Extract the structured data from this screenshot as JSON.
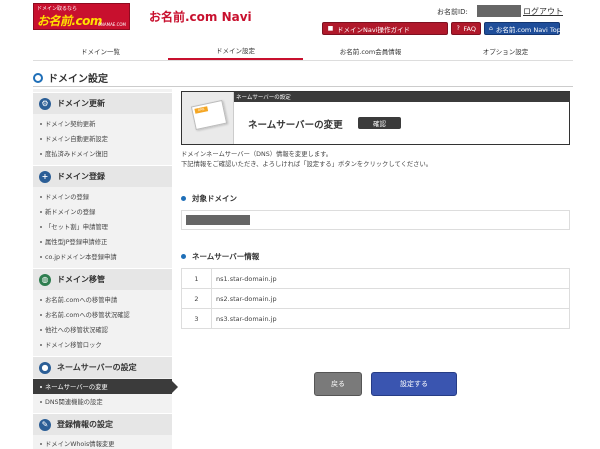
{
  "header": {
    "logo_small": "ドメイン取るなら",
    "logo_main": "お名前.com",
    "logo_sub": "ONAMAE.COM",
    "site_title": "お名前.com Navi",
    "user_id_label": "お名前ID:",
    "logout": "ログアウト",
    "buttons": {
      "guide": "ドメインNavi操作ガイド",
      "faq": "FAQ",
      "top": "お名前.com Navi Topへ"
    }
  },
  "gnav": {
    "items": [
      "ドメイン一覧",
      "ドメイン設定",
      "お名前.com会員情報",
      "オプション設定"
    ],
    "active_index": 1
  },
  "page": {
    "title": "ドメイン設定"
  },
  "sidebar": {
    "sections": [
      {
        "title": "ドメイン更新",
        "icon": "gear-icon",
        "items": [
          "ドメイン契約更新",
          "ドメイン自動更新設定",
          "度払済みドメイン復旧"
        ]
      },
      {
        "title": "ドメイン登録",
        "icon": "plus-icon",
        "items": [
          "ドメインの登録",
          "新ドメインの登録",
          "「セット割」申請管理",
          "属性型JP登録申請修正",
          "co.jpドメイン本登録申請"
        ]
      },
      {
        "title": "ドメイン移管",
        "icon": "globe-icon",
        "items": [
          "お名前.comへの移管申請",
          "お名前.comへの移管状況確認",
          "他社への移管状況確認",
          "ドメイン移管ロック"
        ]
      },
      {
        "title": "ネームサーバーの設定",
        "icon": "person-icon",
        "items": [
          "ネームサーバーの変更",
          "DNS関連機能の設定"
        ],
        "active_index": 0
      },
      {
        "title": "登録情報の設定",
        "icon": "pencil-icon",
        "items": [
          "ドメインWhois情報変更"
        ]
      }
    ]
  },
  "main": {
    "box_topbar": "ネームサーバーの設定",
    "box_title": "ネームサーバーの変更",
    "box_badge": "確認",
    "card_tag": "DNS",
    "desc_line1": "ドメインネームサーバー（DNS）情報を変更します。",
    "desc_line2": "下記情報をご確認いただき、よろしければ「設定する」ボタンをクリックしてください。",
    "target_heading": "対象ドメイン",
    "ns_heading": "ネームサーバー情報",
    "ns_rows": [
      {
        "num": "1",
        "value": "ns1.star-domain.jp"
      },
      {
        "num": "2",
        "value": "ns2.star-domain.jp"
      },
      {
        "num": "3",
        "value": "ns3.star-domain.jp"
      }
    ],
    "back_button": "戻る",
    "submit_button": "設定する"
  },
  "colors": {
    "brand_red": "#c8102e",
    "nav_blue": "#1f4e9a",
    "submit_blue": "#3a55b0",
    "dark": "#3b3b3b"
  }
}
